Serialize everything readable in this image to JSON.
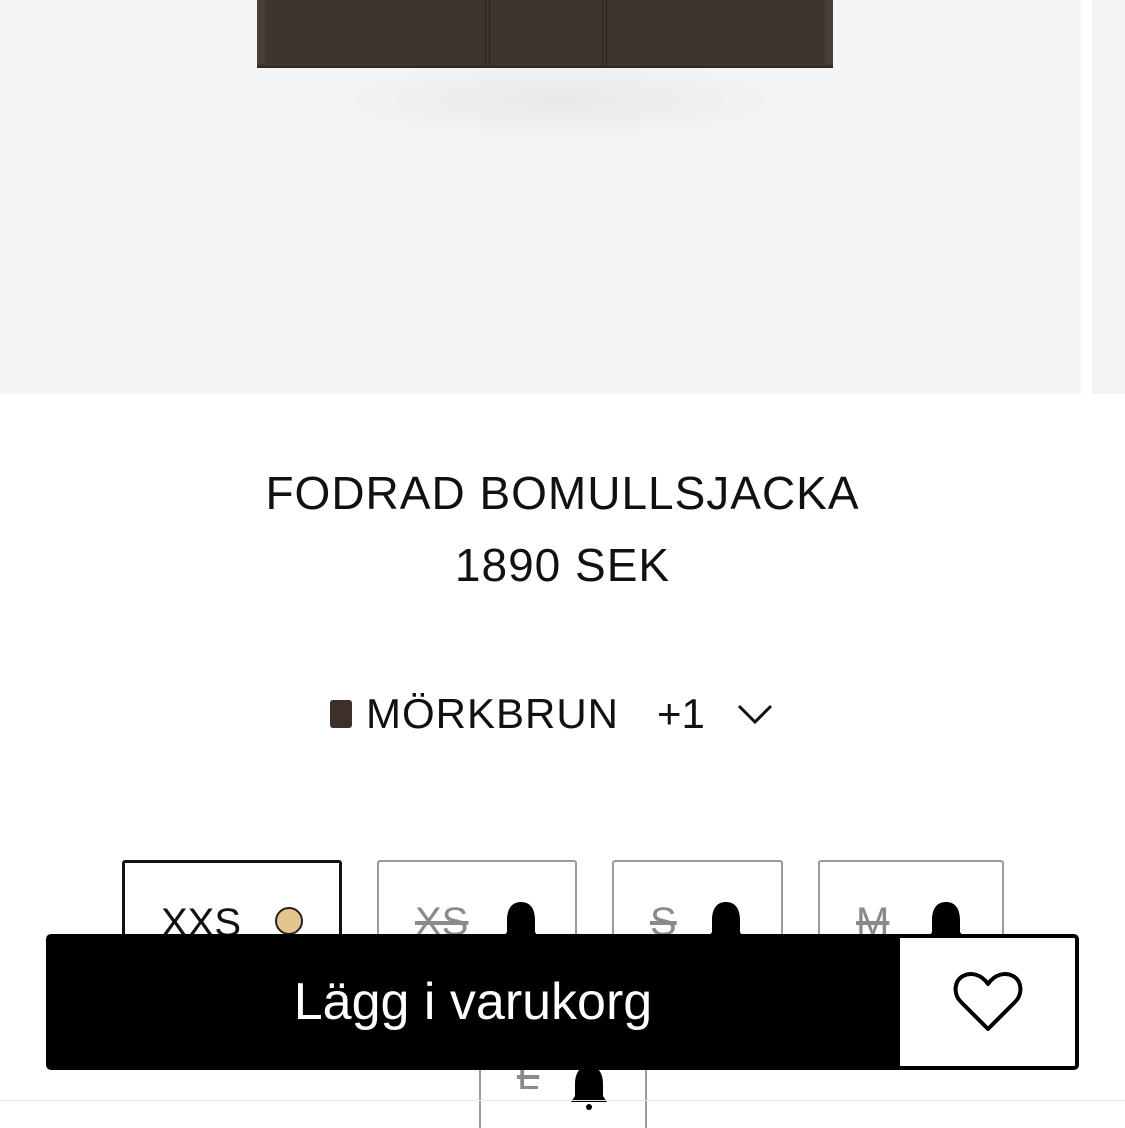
{
  "product": {
    "title": "FODRAD BOMULLSJACKA",
    "price": "1890 SEK"
  },
  "color": {
    "name": "MÖRKBRUN",
    "more": "+1",
    "swatch_hex": "#3d302c",
    "expand_icon": "chevron-down-icon"
  },
  "sizes": [
    {
      "label": "XXS",
      "available": true,
      "indicator": "low-stock-dot",
      "indicator_color": "#e6c48e",
      "selected": true
    },
    {
      "label": "XS",
      "available": false,
      "indicator": "bell-icon"
    },
    {
      "label": "S",
      "available": false,
      "indicator": "bell-icon"
    },
    {
      "label": "M",
      "available": false,
      "indicator": "bell-icon"
    },
    {
      "label": "L",
      "available": false,
      "indicator": "bell-icon"
    }
  ],
  "actions": {
    "add_to_cart_label": "Lägg i varukorg",
    "wishlist_icon": "heart-icon"
  },
  "colors": {
    "button_bg": "#000000",
    "page_bg": "#ffffff",
    "image_bg": "#f5f5f5"
  }
}
